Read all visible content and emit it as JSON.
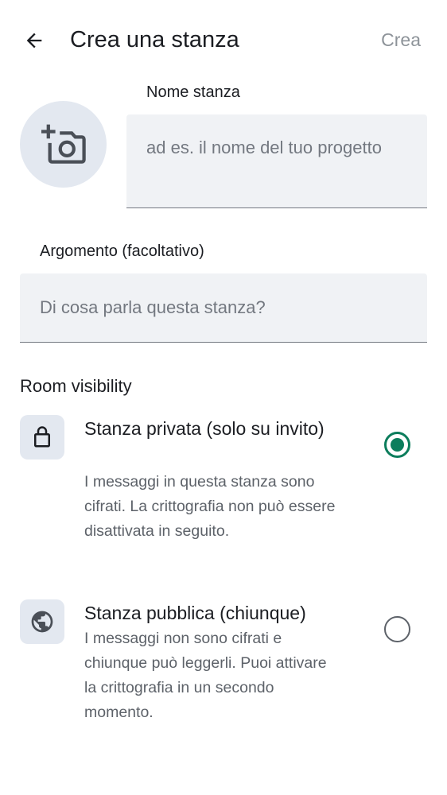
{
  "header": {
    "back_icon": "arrow-left-icon",
    "title": "Crea una stanza",
    "create_label": "Crea"
  },
  "avatar": {
    "icon": "add-photo-camera-icon"
  },
  "name_field": {
    "label": "Nome stanza",
    "placeholder": "ad es. il nome del tuo progetto",
    "value": ""
  },
  "topic_field": {
    "label": "Argomento (facoltativo)",
    "placeholder": "Di cosa parla questa stanza?",
    "value": ""
  },
  "visibility": {
    "section_title": "Room visibility",
    "accent_color": "#0c7d5c",
    "options": [
      {
        "icon": "lock-icon",
        "title": "Stanza privata (solo su invito)",
        "description": "I messaggi in questa stanza sono cifrati. La crittografia non può essere disattivata in seguito.",
        "selected": true
      },
      {
        "icon": "globe-icon",
        "title": "Stanza pubblica (chiunque)",
        "description": "I messaggi non sono cifrati e chiunque può leggerli. Puoi attivare la crittografia in un secondo momento.",
        "selected": false
      }
    ]
  }
}
